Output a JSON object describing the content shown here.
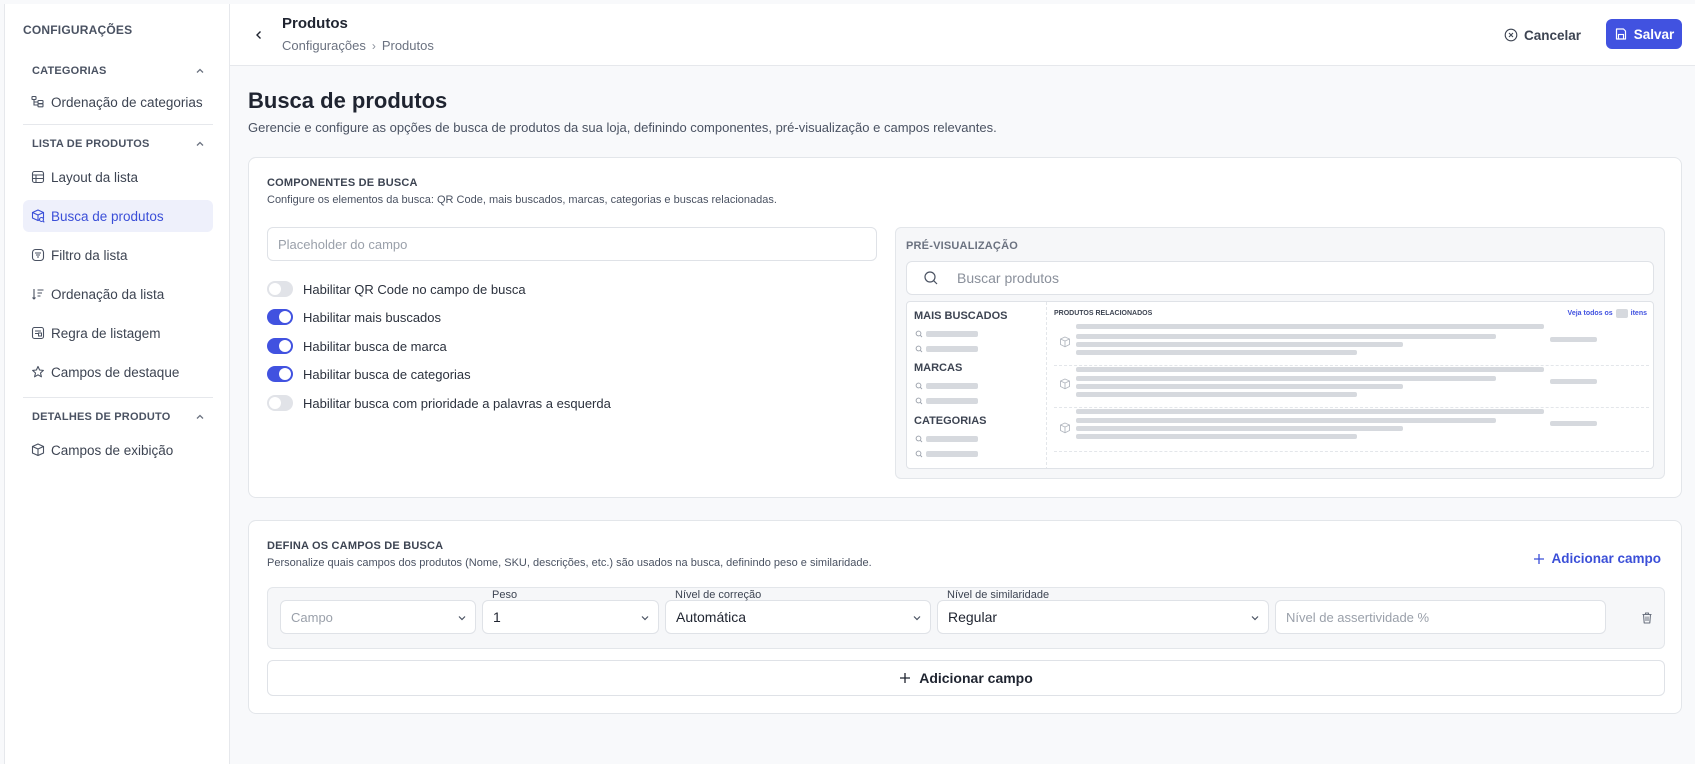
{
  "sidebar": {
    "title": "CONFIGURAÇÕES",
    "sections": [
      {
        "label": "CATEGORIAS",
        "items": [
          {
            "label": "Ordenação de categorias",
            "icon": "hierarchy-icon"
          }
        ]
      },
      {
        "label": "LISTA DE PRODUTOS",
        "items": [
          {
            "label": "Layout da lista",
            "icon": "table-icon"
          },
          {
            "label": "Busca de produtos",
            "icon": "box-search-icon",
            "active": true
          },
          {
            "label": "Filtro da lista",
            "icon": "filter-icon"
          },
          {
            "label": "Ordenação da lista",
            "icon": "sort-icon"
          },
          {
            "label": "Regra de listagem",
            "icon": "rule-icon"
          },
          {
            "label": "Campos de destaque",
            "icon": "star-icon"
          }
        ]
      },
      {
        "label": "DETALHES DE PRODUTO",
        "items": [
          {
            "label": "Campos de exibição",
            "icon": "cube-icon"
          }
        ]
      }
    ]
  },
  "header": {
    "title": "Produtos",
    "breadcrumb": [
      "Configurações",
      "Produtos"
    ],
    "cancel_label": "Cancelar",
    "save_label": "Salvar"
  },
  "page": {
    "title": "Busca de produtos",
    "description": "Gerencie e configure as opções de busca de produtos da sua loja, definindo componentes, pré-visualização e campos relevantes."
  },
  "components": {
    "title": "COMPONENTES DE BUSCA",
    "subtitle": "Configure os elementos da busca: QR Code, mais buscados, marcas, categorias e buscas relacionadas.",
    "placeholder_input": "Placeholder do campo",
    "toggles": [
      {
        "label": "Habilitar QR Code no campo de busca",
        "on": false
      },
      {
        "label": "Habilitar mais buscados",
        "on": true
      },
      {
        "label": "Habilitar busca de marca",
        "on": true
      },
      {
        "label": "Habilitar busca de categorias",
        "on": true
      },
      {
        "label": "Habilitar busca com prioridade a palavras a esquerda",
        "on": false
      }
    ]
  },
  "preview": {
    "label": "PRÉ-VISUALIZAÇÃO",
    "search_placeholder": "Buscar produtos",
    "most_searched": "MAIS BUSCADOS",
    "brands": "MARCAS",
    "categories": "CATEGORIAS",
    "related": "PRODUTOS RELACIONADOS",
    "see_all_prefix": "Veja todos os",
    "see_all_suffix": "itens"
  },
  "fields": {
    "title": "DEFINA OS CAMPOS DE BUSCA",
    "subtitle": "Personalize quais campos dos produtos (Nome, SKU, descrições, etc.) são usados na busca, definindo peso e similaridade.",
    "add_link": "Adicionar campo",
    "row": {
      "campo_placeholder": "Campo",
      "peso_label": "Peso",
      "peso_value": "1",
      "correcao_label": "Nível de correção",
      "correcao_value": "Automática",
      "similaridade_label": "Nível de similaridade",
      "similaridade_value": "Regular",
      "assertividade_placeholder": "Nível de assertividade %"
    },
    "add_button": "Adicionar campo"
  },
  "colors": {
    "accent": "#4152e0",
    "active_bg": "#eef0fb"
  }
}
